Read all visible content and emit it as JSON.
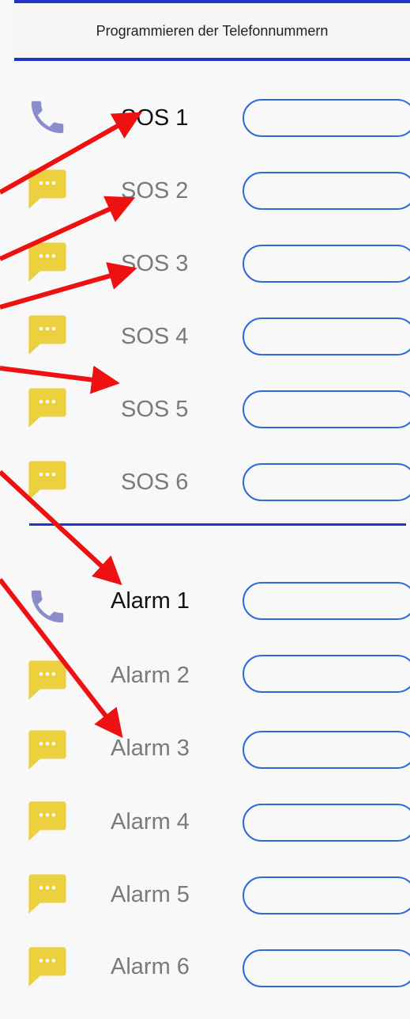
{
  "header": {
    "title": "Programmieren der Telefonnummern"
  },
  "sos": [
    {
      "label": "SOS 1",
      "icon": "phone-icon",
      "active": true,
      "value": ""
    },
    {
      "label": "SOS 2",
      "icon": "message-icon",
      "active": false,
      "value": ""
    },
    {
      "label": "SOS 3",
      "icon": "message-icon",
      "active": false,
      "value": ""
    },
    {
      "label": "SOS 4",
      "icon": "message-icon",
      "active": false,
      "value": ""
    },
    {
      "label": "SOS 5",
      "icon": "message-icon",
      "active": false,
      "value": ""
    },
    {
      "label": "SOS 6",
      "icon": "message-icon",
      "active": false,
      "value": ""
    }
  ],
  "alarm": [
    {
      "label": "Alarm 1",
      "icon": "phone-icon",
      "active": true,
      "value": ""
    },
    {
      "label": "Alarm 2",
      "icon": "message-icon",
      "active": false,
      "value": ""
    },
    {
      "label": "Alarm 3",
      "icon": "message-icon",
      "active": false,
      "value": ""
    },
    {
      "label": "Alarm 4",
      "icon": "message-icon",
      "active": false,
      "value": ""
    },
    {
      "label": "Alarm 5",
      "icon": "message-icon",
      "active": false,
      "value": ""
    },
    {
      "label": "Alarm 6",
      "icon": "message-icon",
      "active": false,
      "value": ""
    }
  ],
  "colors": {
    "accent_blue": "#1f35c8",
    "field_border": "#2d6ad8",
    "phone_icon": "#8c8ccc",
    "message_icon": "#ecd040",
    "annotation_arrow": "#ee1111"
  }
}
